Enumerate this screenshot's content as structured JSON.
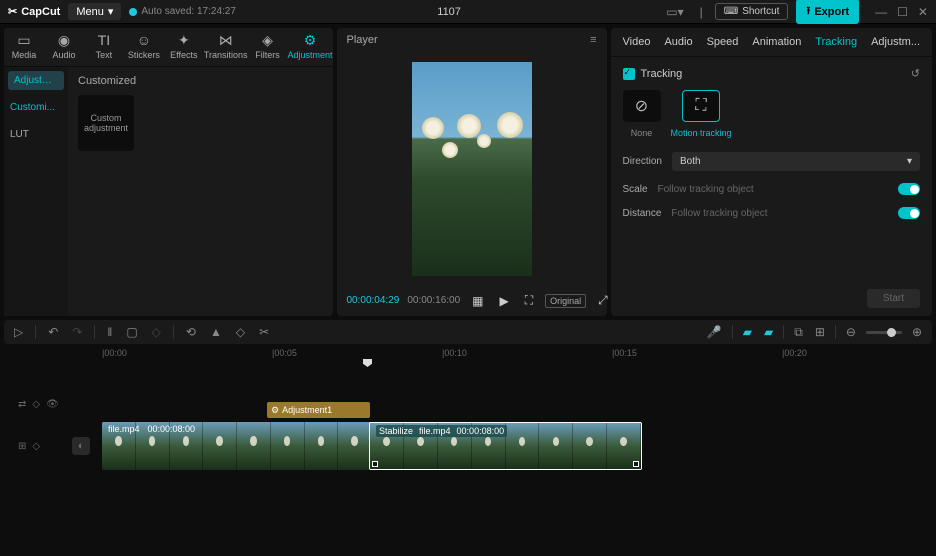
{
  "titlebar": {
    "app_name": "CapCut",
    "menu_label": "Menu",
    "autosave": "Auto saved: 17:24:27",
    "project_title": "1107",
    "shortcut_label": "Shortcut",
    "export_label": "Export"
  },
  "top_tabs": [
    {
      "label": "Media"
    },
    {
      "label": "Audio"
    },
    {
      "label": "Text"
    },
    {
      "label": "Stickers"
    },
    {
      "label": "Effects"
    },
    {
      "label": "Transitions"
    },
    {
      "label": "Filters"
    },
    {
      "label": "Adjustment"
    }
  ],
  "side_nav": {
    "items": [
      "Adjustment",
      "Customi...",
      "LUT"
    ]
  },
  "left_content": {
    "section_title": "Customized",
    "card_label": "Custom adjustment"
  },
  "player": {
    "title": "Player",
    "time_current": "00:00:04:29",
    "time_duration": "00:00:16:00",
    "quality": "Original"
  },
  "inspector": {
    "tabs": [
      "Video",
      "Audio",
      "Speed",
      "Animation",
      "Tracking",
      "Adjustm..."
    ],
    "section_title": "Tracking",
    "options": [
      {
        "label": "None"
      },
      {
        "label": "Motion tracking"
      }
    ],
    "direction_label": "Direction",
    "direction_value": "Both",
    "scale_label": "Scale",
    "scale_sub": "Follow tracking object",
    "distance_label": "Distance",
    "distance_sub": "Follow tracking object",
    "start_label": "Start"
  },
  "timeline": {
    "ruler": [
      "|00:00",
      "|00:05",
      "|00:10",
      "|00:15",
      "|00:20"
    ],
    "adjustment_clip": "Adjustment1",
    "clip1": {
      "name": "file.mp4",
      "duration": "00:00:08:00"
    },
    "clip2": {
      "effect": "Stabilize",
      "name": "file.mp4",
      "duration": "00:00:08:00"
    }
  }
}
